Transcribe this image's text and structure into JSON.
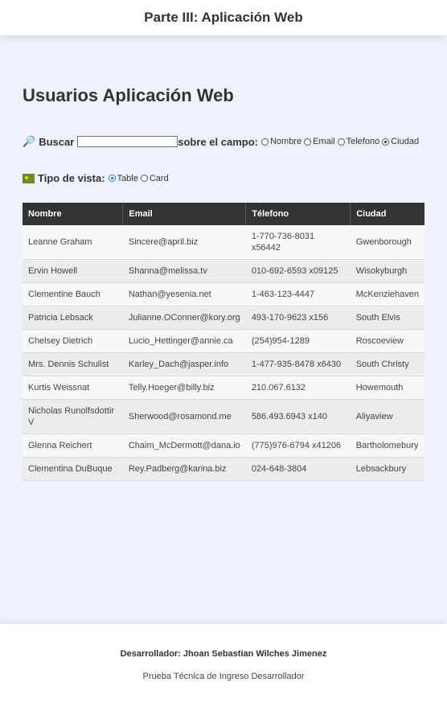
{
  "header": {
    "title": "Parte III: Aplicación Web"
  },
  "main": {
    "title": "Usuarios Aplicación Web",
    "search": {
      "icon": "magnifier-icon",
      "label": "Buscar",
      "value": "",
      "field_label": "sobre el campo:",
      "options": [
        "Nombre",
        "Email",
        "Telefono",
        "Ciudad"
      ],
      "selected": "Ciudad"
    },
    "view": {
      "icon": "picture-icon",
      "label": "Tipo de vista:",
      "options": [
        "Table",
        "Card"
      ],
      "selected": "Table"
    },
    "table": {
      "headers": [
        "Nombre",
        "Email",
        "Télefono",
        "Ciudad"
      ],
      "rows": [
        [
          "Leanne Graham",
          "Sincere@april.biz",
          "1-770-736-8031 x56442",
          "Gwenborough"
        ],
        [
          "Ervin Howell",
          "Shanna@melissa.tv",
          "010-692-6593 x09125",
          "Wisokyburgh"
        ],
        [
          "Clementine Bauch",
          "Nathan@yesenia.net",
          "1-463-123-4447",
          "McKenziehaven"
        ],
        [
          "Patricia Lebsack",
          "Julianne.OConner@kory.org",
          "493-170-9623 x156",
          "South Elvis"
        ],
        [
          "Chelsey Dietrich",
          "Lucio_Hettinger@annie.ca",
          "(254)954-1289",
          "Roscoeview"
        ],
        [
          "Mrs. Dennis Schulist",
          "Karley_Dach@jasper.info",
          "1-477-935-8478 x6430",
          "South Christy"
        ],
        [
          "Kurtis Weissnat",
          "Telly.Hoeger@billy.biz",
          "210.067.6132",
          "Howemouth"
        ],
        [
          "Nicholas Runolfsdottir V",
          "Sherwood@rosamond.me",
          "586.493.6943 x140",
          "Aliyaview"
        ],
        [
          "Glenna Reichert",
          "Chaim_McDermott@dana.io",
          "(775)976-6794 x41206",
          "Bartholomebury"
        ],
        [
          "Clementina DuBuque",
          "Rey.Padberg@karina.biz",
          "024-648-3804",
          "Lebsackbury"
        ]
      ]
    }
  },
  "footer": {
    "developer": "Desarrollador: Jhoan Sebastian Wilches Jimenez",
    "subtitle": "Prueba Técnica de Ingreso Desarrollador"
  }
}
